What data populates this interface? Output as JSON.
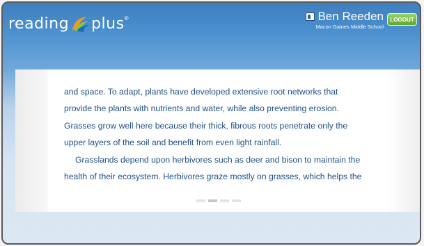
{
  "brand": {
    "left_word": "reading",
    "right_word": "plus",
    "trademark": "®"
  },
  "user": {
    "name": "Ben Reeden",
    "school": "Macon Gaines Middle School"
  },
  "logout_label": "LOGOUT",
  "reading": {
    "lines": [
      "and space. To adapt, plants have developed extensive root networks that",
      "provide the plants with nutrients and water, while also preventing erosion.",
      "Grasses grow well here because their thick, fibrous roots penetrate only the",
      "upper layers of the soil and benefit from even light rainfall.",
      "Grasslands depend upon herbivores such as deer and bison to maintain the",
      "health of their ecosystem. Herbivores graze mostly on grasses, which helps the"
    ]
  },
  "pager": {
    "pages": 4,
    "current": 2
  },
  "colors": {
    "accent_blue": "#4a8fcf",
    "text_blue": "#1f4f86",
    "logout_green": "#5fa634"
  }
}
